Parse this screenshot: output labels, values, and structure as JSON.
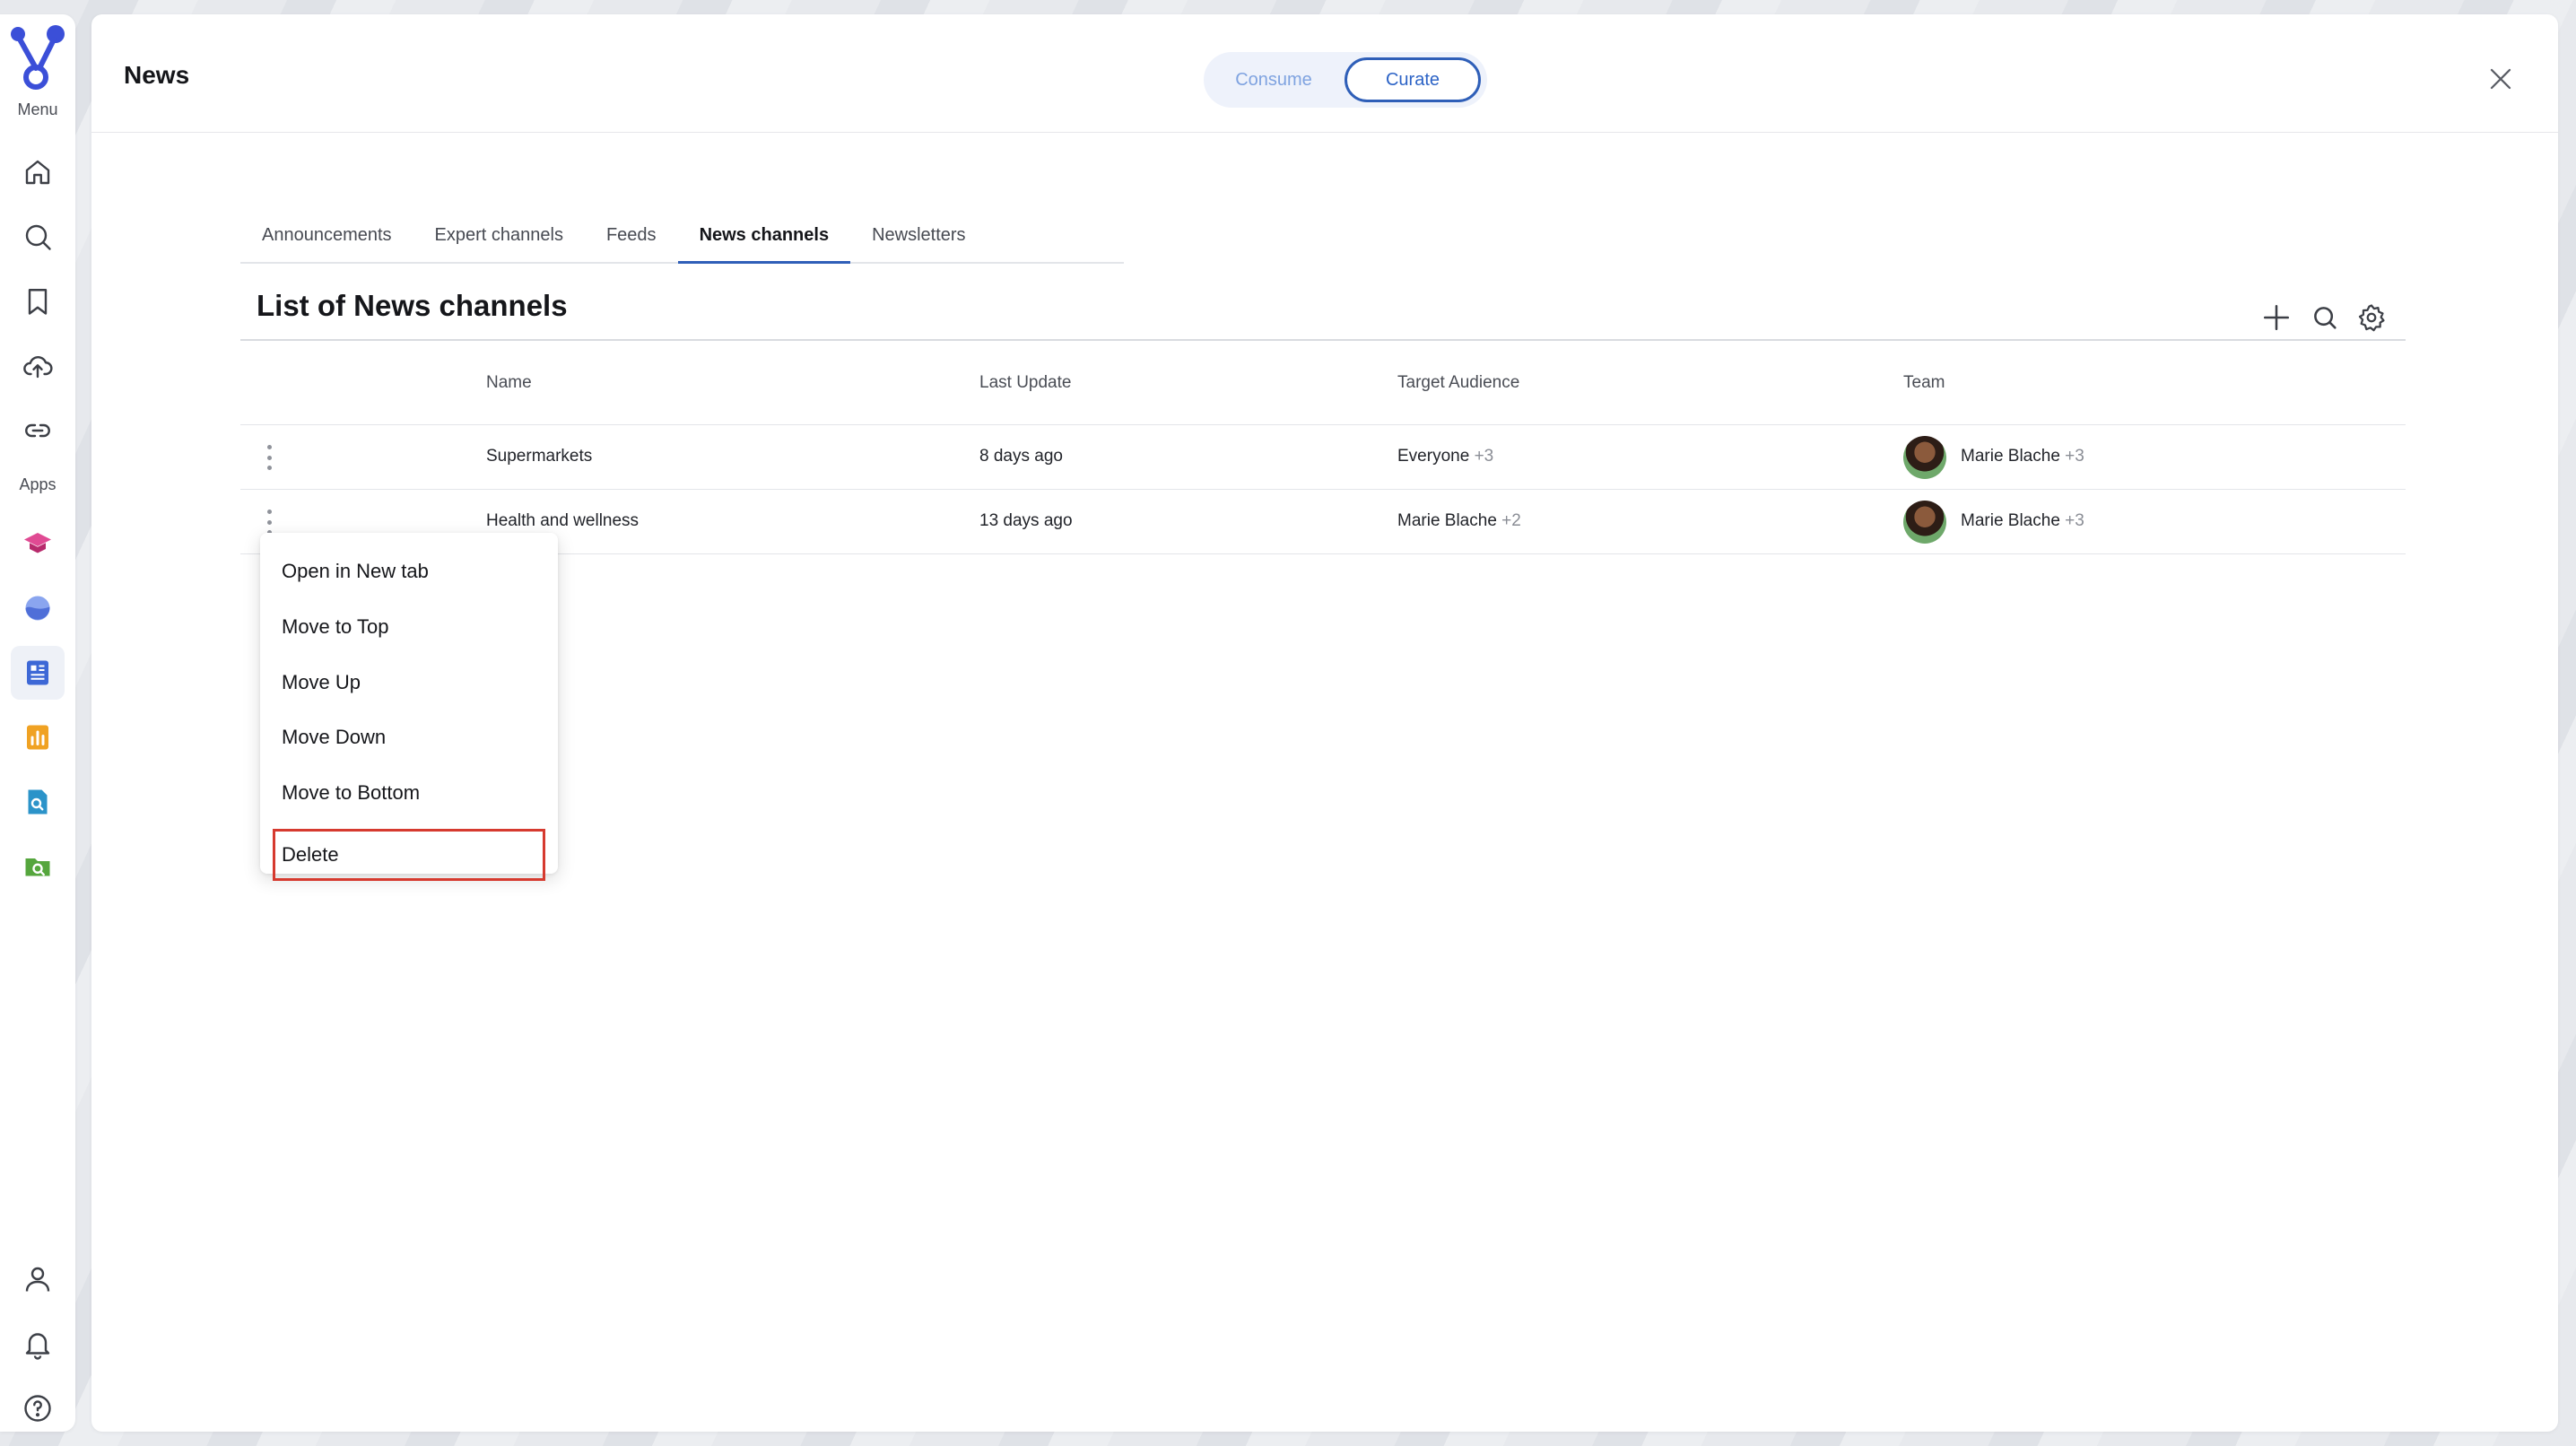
{
  "rail": {
    "menu_label": "Menu",
    "apps_label": "Apps",
    "nav": [
      {
        "icon": "home-icon"
      },
      {
        "icon": "search-icon"
      },
      {
        "icon": "bookmark-icon"
      },
      {
        "icon": "upload-cloud-icon"
      },
      {
        "icon": "link-icon"
      }
    ],
    "apps": [
      {
        "icon": "graduation-cap-icon",
        "color": "#d6357e"
      },
      {
        "icon": "wave-app-icon",
        "color": "#4f6fd8"
      },
      {
        "icon": "news-app-icon",
        "color": "#3d68d6"
      },
      {
        "icon": "chart-app-icon",
        "color": "#f0a223"
      },
      {
        "icon": "document-search-icon",
        "color": "#2b93c9"
      },
      {
        "icon": "folder-search-icon",
        "color": "#55a63d"
      }
    ],
    "bottom": [
      {
        "icon": "user-icon"
      },
      {
        "icon": "bell-icon"
      },
      {
        "icon": "help-icon"
      }
    ],
    "brand_color": "#3b4fd8"
  },
  "header": {
    "title": "News",
    "modes": {
      "consume": "Consume",
      "curate": "Curate"
    },
    "active_mode": "Curate",
    "accent": "#2f5fb8"
  },
  "tabs": [
    {
      "label": "Announcements"
    },
    {
      "label": "Expert channels"
    },
    {
      "label": "Feeds"
    },
    {
      "label": "News channels"
    },
    {
      "label": "Newsletters"
    }
  ],
  "active_tab": "News channels",
  "list": {
    "title": "List of News channels",
    "columns": [
      "Name",
      "Last Update",
      "Target Audience",
      "Team"
    ],
    "rows": [
      {
        "name": "Supermarkets",
        "last_update": "8 days ago",
        "audience": "Everyone",
        "audience_more": "+3",
        "team": "Marie Blache",
        "team_more": "+3"
      },
      {
        "name": "Health and wellness",
        "last_update": "13 days ago",
        "audience": "Marie Blache",
        "audience_more": "+2",
        "team": "Marie Blache",
        "team_more": "+3"
      }
    ]
  },
  "context_menu": {
    "items": [
      "Open in New tab",
      "Move to Top",
      "Move Up",
      "Move Down",
      "Move to Bottom",
      "Delete"
    ],
    "highlighted": "Delete",
    "highlight_color": "#d63a2f"
  }
}
